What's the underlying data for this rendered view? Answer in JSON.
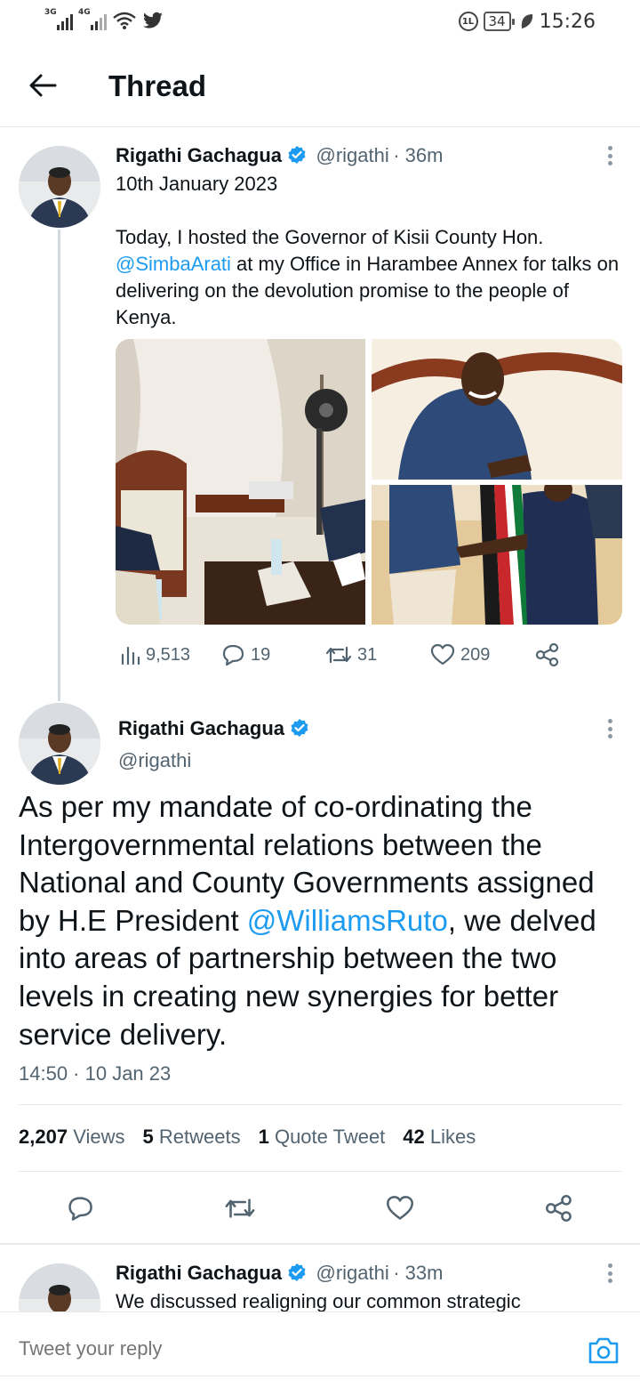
{
  "status_bar": {
    "net1": "3G",
    "net2": "4G",
    "battery": "34",
    "time": "15:26",
    "icons": [
      "signal-icon",
      "wifi-icon",
      "twitter-bird-icon",
      "data-saver-icon",
      "battery-icon",
      "leaf-icon"
    ]
  },
  "header": {
    "title": "Thread",
    "back_icon": "arrow-left-icon"
  },
  "tweet1": {
    "name": "Rigathi Gachagua",
    "handle": "@rigathi",
    "time": "· 36m",
    "date_line": "10th January 2023",
    "text_before": "Today, I hosted the Governor of Kisii County Hon. ",
    "mention": "@SimbaArati",
    "text_after": " at my Office in Harambee Annex for talks on delivering on the devolution promise to the people of Kenya.",
    "actions": {
      "views": "9,513",
      "replies": "19",
      "retweets": "31",
      "likes": "209"
    }
  },
  "tweet2": {
    "name": "Rigathi Gachagua",
    "handle": "@rigathi",
    "text_before": "As per my mandate of co-ordinating the Intergovernmental relations between the National and County Governments assigned by H.E President ",
    "mention": "@WilliamsRuto",
    "text_after": ", we delved into areas of partnership between the two levels in creating new synergies for better service delivery.",
    "timestamp": "14:50 · 10 Jan 23",
    "stats": {
      "views_count": "2,207",
      "views_label": "Views",
      "retweets_count": "5",
      "retweets_label": "Retweets",
      "quotes_count": "1",
      "quotes_label": "Quote Tweet",
      "likes_count": "42",
      "likes_label": "Likes"
    }
  },
  "tweet3": {
    "name": "Rigathi Gachagua",
    "handle": "@rigathi",
    "time": "· 33m",
    "text": "We discussed realigning our common strategic"
  },
  "reply": {
    "placeholder": "Tweet your reply"
  },
  "colors": {
    "accent": "#1d9bf0",
    "text": "#0f1419",
    "secondary": "#536471",
    "border": "#e6e9eb"
  }
}
